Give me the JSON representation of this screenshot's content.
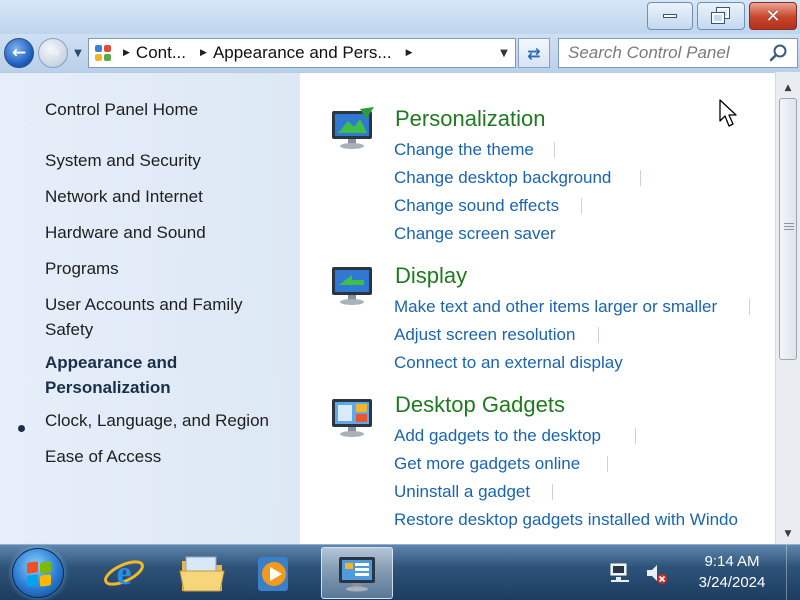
{
  "window": {
    "controls": {
      "minimize_icon": "minimize-icon",
      "maximize_icon": "restore-icon",
      "close_icon": "close-icon",
      "close_glyph": "✕"
    }
  },
  "nav": {
    "back_glyph": "←",
    "forward_glyph": "→",
    "breadcrumbs": [
      "Cont...",
      "Appearance and Pers..."
    ],
    "refresh_glyph": "⇄",
    "search_placeholder": "Search Control Panel"
  },
  "sidebar": {
    "items": [
      {
        "label": "Control Panel Home"
      },
      {
        "label": "System and Security"
      },
      {
        "label": "Network and Internet"
      },
      {
        "label": "Hardware and Sound"
      },
      {
        "label": "Programs"
      },
      {
        "label": "User Accounts and Family Safety",
        "line1": "User Accounts and Family",
        "line2": "Safety"
      },
      {
        "label": "Appearance and Personalization",
        "line1": "Appearance and",
        "line2": "Personalization",
        "current": true
      },
      {
        "label": "Clock, Language, and Region"
      },
      {
        "label": "Ease of Access"
      }
    ]
  },
  "categories": [
    {
      "title": "Personalization",
      "icon": "personalization-icon",
      "tasks": [
        "Change the theme",
        "Change desktop background",
        "Change sound effects",
        "Change screen saver"
      ]
    },
    {
      "title": "Display",
      "icon": "display-icon",
      "tasks": [
        "Make text and other items larger or smaller",
        "Adjust screen resolution",
        "Connect to an external display"
      ]
    },
    {
      "title": "Desktop Gadgets",
      "icon": "desktop-gadgets-icon",
      "tasks": [
        "Add gadgets to the desktop",
        "Get more gadgets online",
        "Uninstall a gadget",
        "Restore desktop gadgets installed with Windo"
      ]
    }
  ],
  "taskbar": {
    "apps": [
      "start-button",
      "internet-explorer",
      "windows-explorer",
      "windows-media-player",
      "control-panel"
    ],
    "clock": {
      "time": "9:14 AM",
      "date": "3/24/2024"
    }
  },
  "colors": {
    "link": "#1a64b0",
    "category": "#1f7a1f",
    "sidebar_bg": "#e6eef9"
  }
}
